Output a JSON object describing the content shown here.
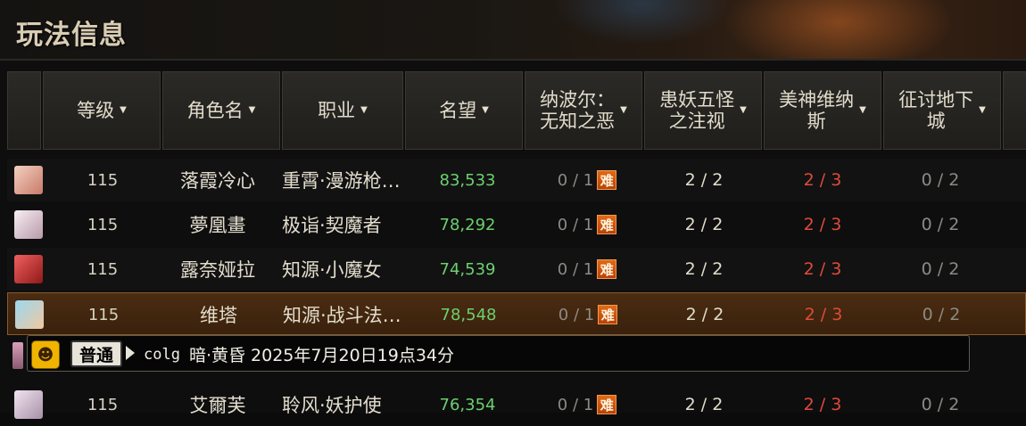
{
  "title": "玩法信息",
  "columns": [
    {
      "label": "",
      "arrow": ""
    },
    {
      "label": "等级",
      "arrow": "▼"
    },
    {
      "label": "角色名",
      "arrow": "▼"
    },
    {
      "label": "职业",
      "arrow": "▼"
    },
    {
      "label": "名望",
      "arrow": "▼"
    },
    {
      "label": "纳波尔：\n无知之恶",
      "arrow": "▼"
    },
    {
      "label": "患妖五怪\n之注视",
      "arrow": "▼"
    },
    {
      "label": "美神维纳\n斯",
      "arrow": "▼"
    },
    {
      "label": "征讨地下\n城",
      "arrow": "▼"
    }
  ],
  "badge_text": "难",
  "rows": [
    {
      "avatar_color": "#e8b0a0",
      "level": "115",
      "name": "落霞冷心",
      "job": "重霄·漫游枪…",
      "fame": "83,533",
      "c1": "0 / 1",
      "c2": "2 / 2",
      "c3": "2 / 3",
      "c4": "0 / 2"
    },
    {
      "avatar_color": "#e8d8e0",
      "level": "115",
      "name": "夢凰畫",
      "job": "极诣·契魔者",
      "fame": "78,292",
      "c1": "0 / 1",
      "c2": "2 / 2",
      "c3": "2 / 3",
      "c4": "0 / 2"
    },
    {
      "avatar_color": "#d03030",
      "level": "115",
      "name": "露奈娅拉",
      "job": "知源·小魔女",
      "fame": "74,539",
      "c1": "0 / 1",
      "c2": "2 / 2",
      "c3": "2 / 3",
      "c4": "0 / 2"
    },
    {
      "avatar_color": "#60b0d0",
      "level": "115",
      "name": "维塔",
      "job": "知源·战斗法…",
      "fame": "78,548",
      "c1": "0 / 1",
      "c2": "2 / 2",
      "c3": "2 / 3",
      "c4": "0 / 2"
    },
    {
      "avatar_color": "#d0c0d0",
      "level": "115",
      "name": "艾爾芙",
      "job": "聆风·妖护使",
      "fame": "76,354",
      "c1": "0 / 1",
      "c2": "2 / 2",
      "c3": "2 / 3",
      "c4": "0 / 2"
    }
  ],
  "chat": {
    "channel": "普通",
    "username": "colg",
    "message": "暗·黄昏 2025年7月20日19点34分"
  }
}
